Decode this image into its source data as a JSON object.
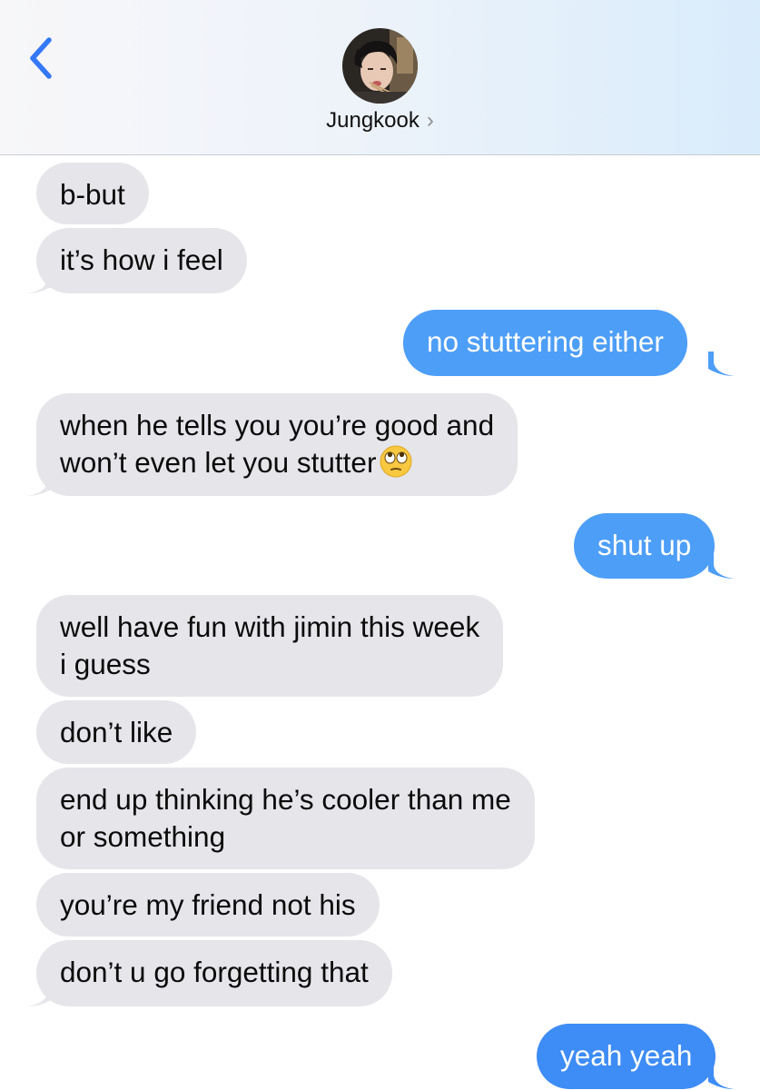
{
  "header": {
    "contact_name": "Jungkook",
    "contact_chevron": "›",
    "back_icon": "chevron-left-icon",
    "accent": "#3478f6"
  },
  "colors": {
    "incoming_bubble": "#e5e5ea",
    "outgoing_bubble": "#4d9ef7",
    "outgoing_text": "#ffffff",
    "incoming_text": "#0a0a0a"
  },
  "messages": [
    {
      "direction": "incoming",
      "text": "b-but"
    },
    {
      "direction": "incoming",
      "text": "it’s how i feel"
    },
    {
      "direction": "outgoing",
      "text": "no stuttering either"
    },
    {
      "direction": "incoming",
      "lines": [
        "when he tells you you’re good and",
        "won’t even let you stutter"
      ],
      "emoji": "face-with-rolling-eyes-icon"
    },
    {
      "direction": "outgoing",
      "text": "shut up"
    },
    {
      "direction": "incoming",
      "lines": [
        "well have fun with jimin this week",
        "i guess"
      ]
    },
    {
      "direction": "incoming",
      "text": "don’t like"
    },
    {
      "direction": "incoming",
      "lines": [
        "end up thinking he’s cooler than me",
        "or something"
      ]
    },
    {
      "direction": "incoming",
      "text": "you’re my friend not his"
    },
    {
      "direction": "incoming",
      "text": "don’t u go forgetting that"
    },
    {
      "direction": "outgoing",
      "text": "yeah yeah"
    }
  ]
}
